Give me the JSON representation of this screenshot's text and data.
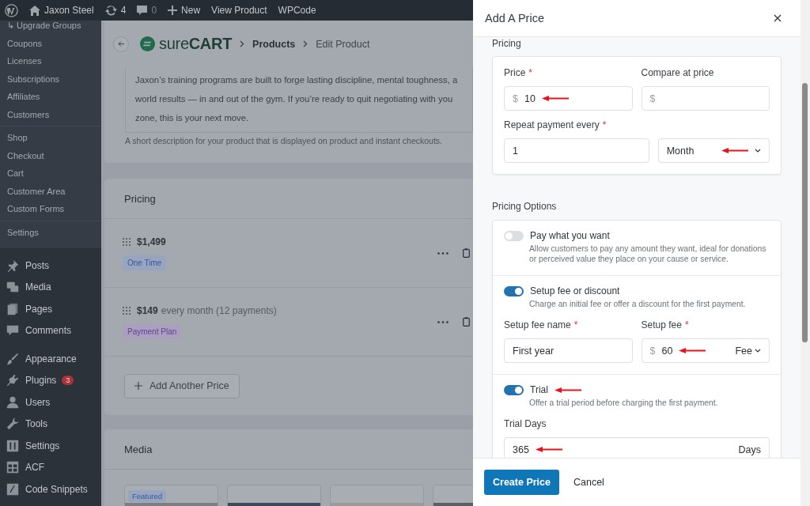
{
  "admin_bar": {
    "site": "Jaxon Steel",
    "updates": "4",
    "comments": "0",
    "new": "New",
    "links": [
      "View Product",
      "WPCode"
    ]
  },
  "sidebar": {
    "submenu_groups": [
      [
        "↳ Upgrade Groups",
        "Coupons",
        "Licenses",
        "Subscriptions",
        "Affiliates",
        "Customers"
      ],
      [
        "Shop",
        "Checkout",
        "Cart",
        "Customer Area",
        "Custom Forms"
      ],
      [
        "Settings"
      ]
    ],
    "menu_groups": [
      [
        {
          "label": "Posts"
        },
        {
          "label": "Media"
        },
        {
          "label": "Pages"
        },
        {
          "label": "Comments"
        }
      ],
      [
        {
          "label": "Appearance"
        },
        {
          "label": "Plugins",
          "badge": "3"
        },
        {
          "label": "Users"
        },
        {
          "label": "Tools"
        },
        {
          "label": "Settings"
        },
        {
          "label": "ACF"
        },
        {
          "label": "Code Snippets"
        }
      ]
    ]
  },
  "page": {
    "logo": "sure**CART**",
    "breadcrumbs": [
      "Products",
      "Edit Product"
    ],
    "description_lines": [
      "Jaxon’s training programs are built to forge lasting discipline, mental toughness, a",
      "world results — in and out of the gym. If you’re ready to quit negotiating with you",
      "zone, this is your next move."
    ],
    "description_hint": "A short description for your product that is displayed on product and instant checkouts.",
    "pricing": {
      "title": "Pricing",
      "prices": [
        {
          "amount": "$1,499",
          "badge": {
            "label": "One Time",
            "kind": "one_time"
          }
        },
        {
          "amount": "$149",
          "detail": "every month (12 payments)",
          "badge": {
            "label": "Payment Plan",
            "kind": "plan"
          }
        }
      ],
      "add_button": "Add Another Price"
    },
    "media": {
      "title": "Media",
      "items": [
        {
          "kind": "picture",
          "badge": "Featured"
        },
        {
          "kind": "picture"
        },
        {
          "kind": "picture"
        },
        {
          "kind": "picture"
        }
      ]
    }
  },
  "drawer": {
    "title": "Add A Price",
    "section": "Pricing",
    "price_fields": [
      {
        "label": "Price",
        "required_mark": "*",
        "prefix": "$",
        "value": "10",
        "arrow": true
      },
      {
        "label": "Compare at price",
        "prefix": "$"
      }
    ],
    "repeat": {
      "label": "Repeat payment every",
      "required_mark": "*",
      "value": "1",
      "unit": "Month",
      "arrow": true
    },
    "options_title": "Pricing Options",
    "options": [
      {
        "title": "Pay what you want",
        "on": false,
        "description": "Allow customers to pay any amount they want, ideal for donations or perceived value they place on your cause or service."
      },
      {
        "title": "Setup fee or discount",
        "on": true,
        "description": "Charge an initial fee or offer a discount for the first payment.",
        "fields": [
          {
            "kind": "text",
            "label": "Setup fee name",
            "required_mark": "*",
            "value": "First year"
          },
          {
            "kind": "money",
            "label": "Setup fee",
            "required_mark": "*",
            "prefix": "$",
            "value": "60",
            "unit": "Fee",
            "arrow": true
          }
        ]
      },
      {
        "title": "Trial",
        "on": true,
        "arrow": true,
        "description": "Offer a trial period before charging the first payment.",
        "fields": [
          {
            "kind": "suffix",
            "label": "Trial Days",
            "value": "365",
            "suffix": "Days",
            "arrow": true
          }
        ]
      }
    ],
    "buttons": {
      "primary": "Create Price",
      "secondary": "Cancel"
    }
  }
}
